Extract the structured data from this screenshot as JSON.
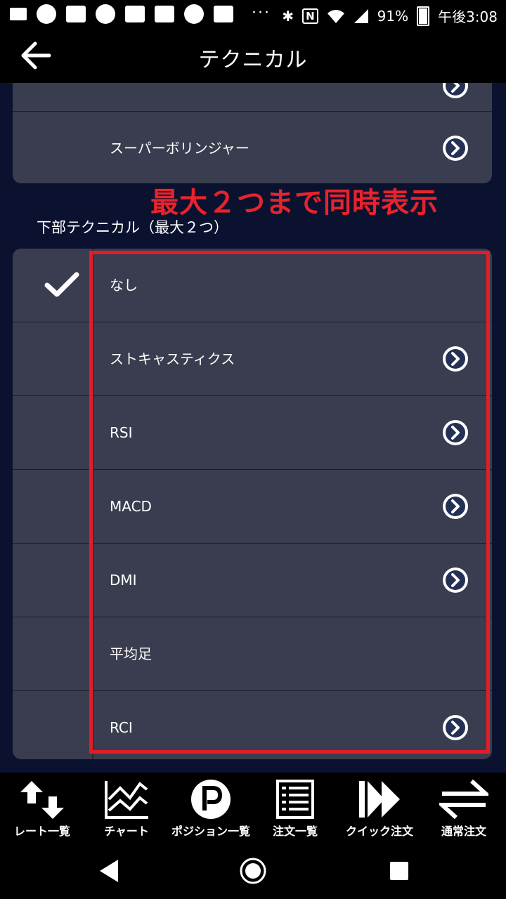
{
  "status": {
    "dots": "···",
    "battery": "91%",
    "time": "午後3:08"
  },
  "appbar": {
    "title": "テクニカル"
  },
  "upper_card": {
    "items": [
      {
        "label": "スーパーボリンジャー",
        "has_detail": true
      }
    ]
  },
  "notice": "最大２つまで同時表示",
  "section": {
    "label": "下部テクニカル（最大２つ）"
  },
  "lower_card": {
    "items": [
      {
        "label": "なし",
        "checked": true,
        "has_detail": false
      },
      {
        "label": "ストキャスティクス",
        "checked": false,
        "has_detail": true
      },
      {
        "label": "RSI",
        "checked": false,
        "has_detail": true
      },
      {
        "label": "MACD",
        "checked": false,
        "has_detail": true
      },
      {
        "label": "DMI",
        "checked": false,
        "has_detail": true
      },
      {
        "label": "平均足",
        "checked": false,
        "has_detail": false
      },
      {
        "label": "RCI",
        "checked": false,
        "has_detail": true
      }
    ]
  },
  "tabbar": {
    "tabs": [
      {
        "label": "レート一覧",
        "icon": "up-down-arrows-icon"
      },
      {
        "label": "チャート",
        "icon": "chart-icon"
      },
      {
        "label": "ポジション一覧",
        "icon": "position-p-icon"
      },
      {
        "label": "注文一覧",
        "icon": "order-list-icon"
      },
      {
        "label": "クイック注文",
        "icon": "fast-forward-icon"
      },
      {
        "label": "通常注文",
        "icon": "swap-icon"
      }
    ]
  },
  "colors": {
    "accent_red": "#e8232b",
    "card": "#3a3d4f",
    "background": "#0b1230"
  }
}
